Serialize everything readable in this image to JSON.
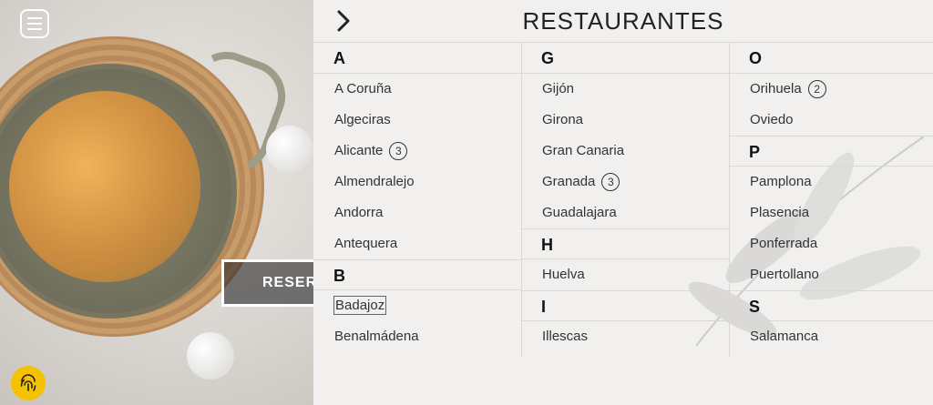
{
  "header": {
    "title": "RESTAURANTES"
  },
  "reserve_label": "RESER",
  "columns": [
    {
      "groups": [
        {
          "letter": "A",
          "items": [
            {
              "name": "A Coruña",
              "count": ""
            },
            {
              "name": "Algeciras",
              "count": ""
            },
            {
              "name": "Alicante",
              "count": "3"
            },
            {
              "name": "Almendralejo",
              "count": ""
            },
            {
              "name": "Andorra",
              "count": ""
            },
            {
              "name": "Antequera",
              "count": ""
            }
          ]
        },
        {
          "letter": "B",
          "items": [
            {
              "name": "Badajoz",
              "count": ""
            },
            {
              "name": "Benalmádena",
              "count": ""
            }
          ]
        }
      ]
    },
    {
      "groups": [
        {
          "letter": "G",
          "items": [
            {
              "name": "Gijón",
              "count": ""
            },
            {
              "name": "Girona",
              "count": ""
            },
            {
              "name": "Gran Canaria",
              "count": ""
            },
            {
              "name": "Granada",
              "count": "3"
            },
            {
              "name": "Guadalajara",
              "count": ""
            }
          ]
        },
        {
          "letter": "H",
          "items": [
            {
              "name": "Huelva",
              "count": ""
            }
          ]
        },
        {
          "letter": "I",
          "items": [
            {
              "name": "Illescas",
              "count": ""
            }
          ]
        }
      ]
    },
    {
      "groups": [
        {
          "letter": "O",
          "items": [
            {
              "name": "Orihuela",
              "count": "2"
            },
            {
              "name": "Oviedo",
              "count": ""
            }
          ]
        },
        {
          "letter": "P",
          "items": [
            {
              "name": "Pamplona",
              "count": ""
            },
            {
              "name": "Plasencia",
              "count": ""
            },
            {
              "name": "Ponferrada",
              "count": ""
            },
            {
              "name": "Puertollano",
              "count": ""
            }
          ]
        },
        {
          "letter": "S",
          "items": [
            {
              "name": "Salamanca",
              "count": ""
            }
          ]
        }
      ]
    }
  ],
  "colors": {
    "accent": "#f5c200",
    "text": "#333333",
    "divider": "#d9d8d5"
  },
  "icons": {
    "menu": "menu-icon",
    "back": "chevron-right-icon",
    "fingerprint": "fingerprint-icon"
  }
}
